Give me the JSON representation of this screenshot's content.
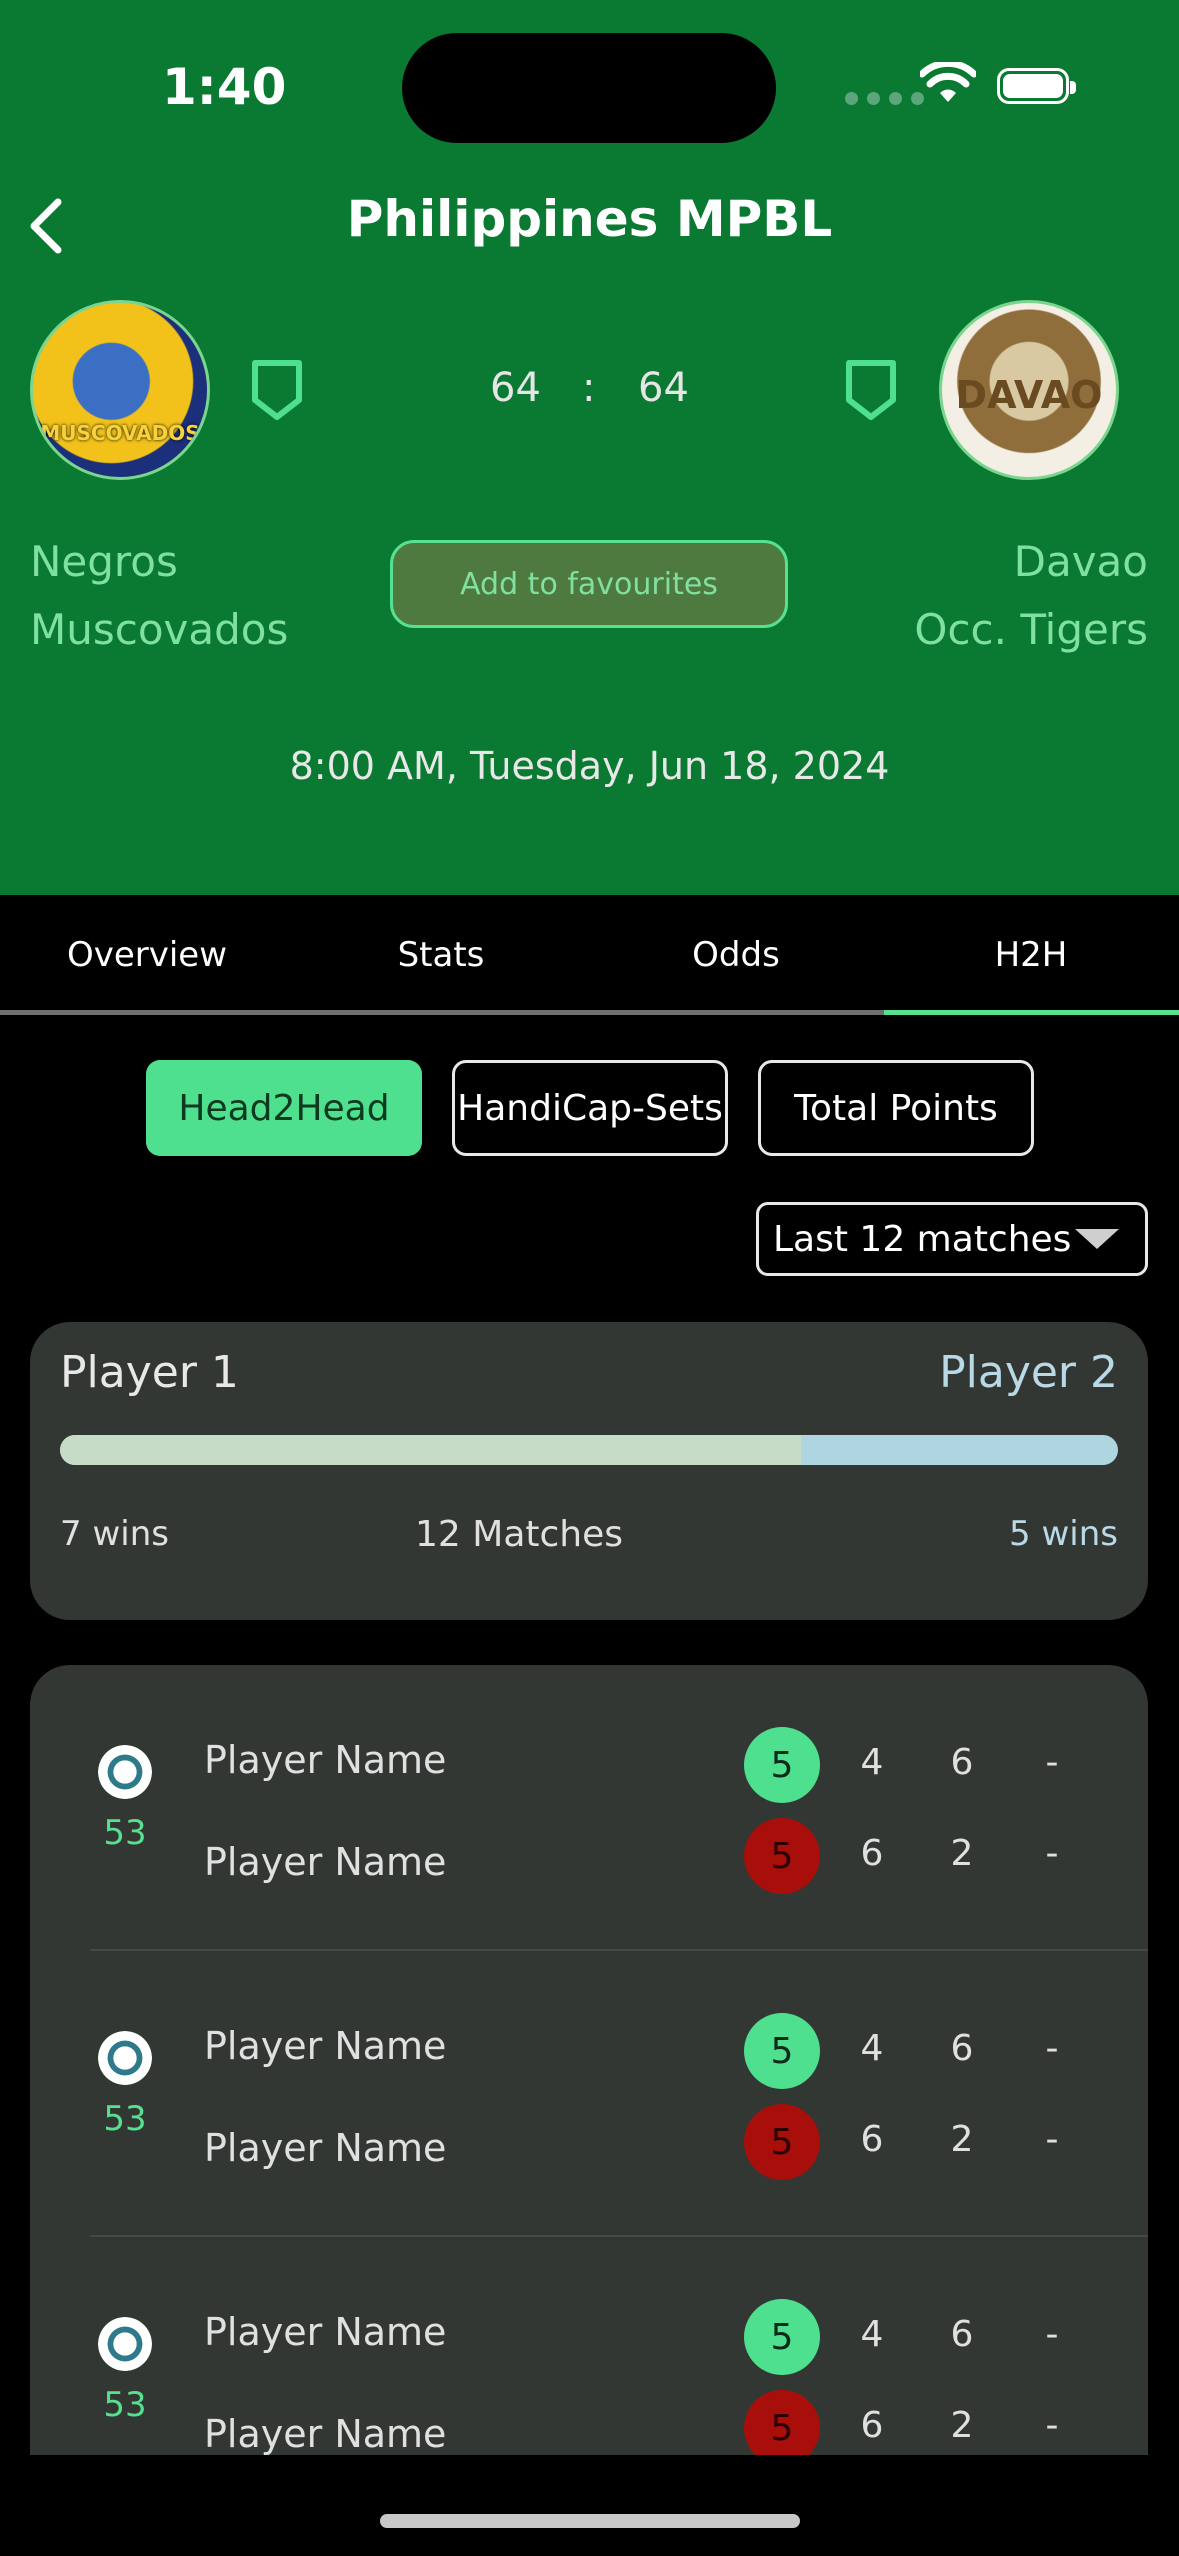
{
  "status_bar": {
    "time": "1:40"
  },
  "header": {
    "title": "Philippines MPBL",
    "home_team": {
      "name_line1": "Negros",
      "name_line2": "Muscovados",
      "logo_text": "MUSCOVADOS"
    },
    "away_team": {
      "name_line1": "Davao",
      "name_line2": "Occ. Tigers",
      "logo_text": "DAVAO"
    },
    "score": {
      "home": "64",
      "separator": ":",
      "away": "64"
    },
    "favourite_label": "Add to favourites",
    "datetime": "8:00 AM, Tuesday, Jun 18, 2024"
  },
  "tabs": [
    {
      "label": "Overview"
    },
    {
      "label": "Stats"
    },
    {
      "label": "Odds"
    },
    {
      "label": "H2H"
    }
  ],
  "active_tab": "H2H",
  "segments": [
    {
      "label": "Head2Head"
    },
    {
      "label": "HandiCap-Sets"
    },
    {
      "label": "Total Points"
    }
  ],
  "active_segment": "Head2Head",
  "filter": {
    "selected": "Last 12 matches"
  },
  "summary": {
    "player1": "Player 1",
    "player2": "Player 2",
    "player1_wins": "7 wins",
    "player2_wins": "5 wins",
    "matches": "12 Matches",
    "player1_share": 0.7
  },
  "matches": [
    {
      "number": "53",
      "player1": "Player Name",
      "player2": "Player Name",
      "p1_total": "5",
      "p2_total": "5",
      "p1_sets": [
        "4",
        "6",
        "-"
      ],
      "p2_sets": [
        "6",
        "2",
        "-"
      ]
    },
    {
      "number": "53",
      "player1": "Player Name",
      "player2": "Player Name",
      "p1_total": "5",
      "p2_total": "5",
      "p1_sets": [
        "4",
        "6",
        "-"
      ],
      "p2_sets": [
        "6",
        "2",
        "-"
      ]
    },
    {
      "number": "53",
      "player1": "Player Name",
      "player2": "Player Name",
      "p1_total": "5",
      "p2_total": "5",
      "p1_sets": [
        "4",
        "6",
        "-"
      ],
      "p2_sets": [
        "6",
        "2",
        "-"
      ]
    }
  ],
  "colors": {
    "header_bg": "#0a7a32",
    "accent": "#4ee08f",
    "loss": "#a80f0a",
    "card_bg": "#333733"
  }
}
